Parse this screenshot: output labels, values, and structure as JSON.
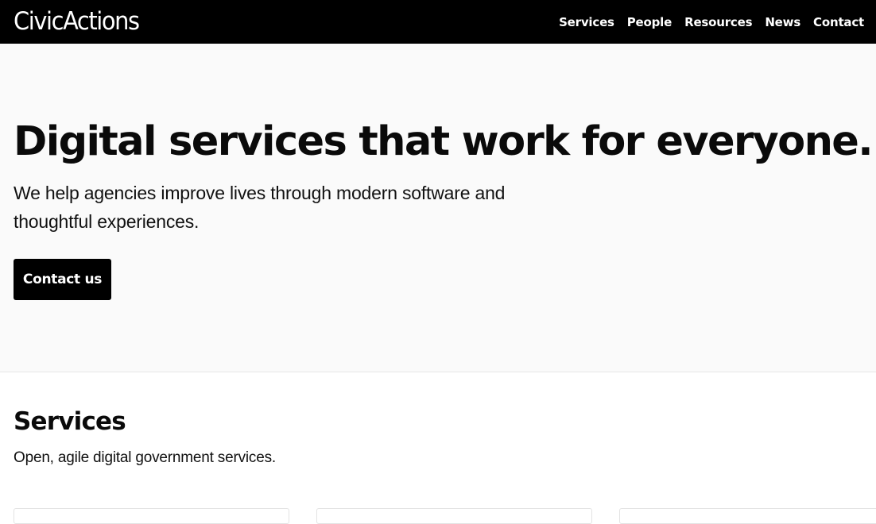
{
  "header": {
    "logo_text": "CivicActions",
    "nav": [
      {
        "label": "Services"
      },
      {
        "label": "People"
      },
      {
        "label": "Resources"
      },
      {
        "label": "News"
      },
      {
        "label": "Contact"
      }
    ]
  },
  "hero": {
    "title": "Digital services that work for everyone.",
    "subtitle": "We help agencies improve lives through modern software and thoughtful experiences.",
    "cta_label": "Contact us"
  },
  "services": {
    "heading": "Services",
    "description": "Open, agile digital government services."
  },
  "colors": {
    "header_bg": "#000000",
    "hero_bg": "#fafafa",
    "cta_bg": "#000000"
  }
}
